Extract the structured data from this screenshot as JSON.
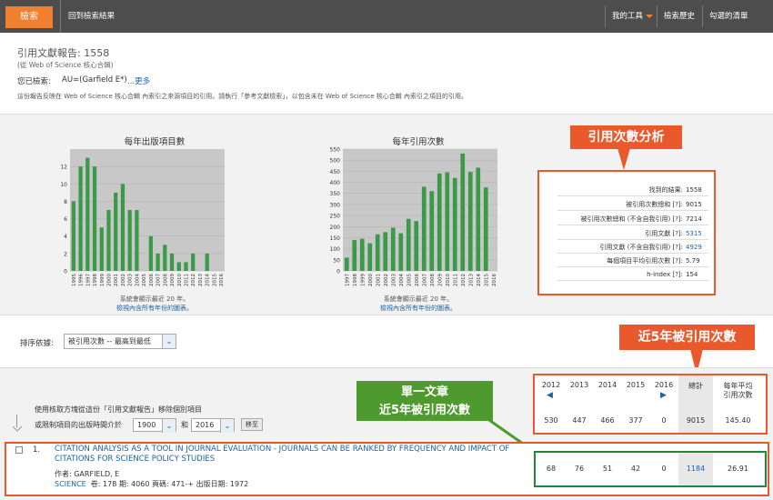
{
  "topbar": {
    "search_tab": "檢索",
    "back_link": "回到檢索結果",
    "tools": "我的工具",
    "history": "檢索歷史",
    "marked": "勾選的清單"
  },
  "report": {
    "title": "引用文獻報告: 1558",
    "subtitle": "(從 Web of Science 核心合輯)",
    "query_label": "您已檢索:",
    "query_value": "AU=(Garfield E*)",
    "more": "...更多",
    "note": "這份報告反映在 Web of Science 核心合輯 內索引之來源項目的引用。請執行「參考文獻檢索」，以包含未在 Web of Science 核心合輯 內索引之項目的引用。"
  },
  "charts": {
    "pubs_title": "每年出版項目數",
    "cites_title": "每年引用次數",
    "note": "系統會顯示最近 20 年。",
    "link": "檢視內含所有年份的圖表。"
  },
  "chart_data": [
    {
      "type": "bar",
      "title": "每年出版項目數",
      "categories": [
        "1995",
        "1996",
        "1997",
        "1998",
        "1999",
        "2000",
        "2001",
        "2002",
        "2003",
        "2004",
        "2005",
        "2006",
        "2007",
        "2008",
        "2009",
        "2010",
        "2011",
        "2012",
        "2013",
        "2014",
        "2015",
        "2016"
      ],
      "values": [
        8,
        12,
        13,
        12,
        5,
        7,
        9,
        10,
        7,
        7,
        0,
        4,
        2,
        3,
        2,
        1,
        1,
        2,
        0,
        2,
        0,
        0
      ],
      "yticks": [
        0,
        2,
        4,
        6,
        8,
        10,
        12
      ],
      "ylim": [
        0,
        14
      ],
      "color": "#3a9a4a"
    },
    {
      "type": "bar",
      "title": "每年引用次數",
      "categories": [
        "1997",
        "1998",
        "1999",
        "2000",
        "2001",
        "2002",
        "2003",
        "2004",
        "2005",
        "2006",
        "2007",
        "2008",
        "2009",
        "2010",
        "2011",
        "2012",
        "2013",
        "2014",
        "2015",
        "2016"
      ],
      "values": [
        60,
        140,
        145,
        125,
        165,
        175,
        195,
        170,
        235,
        225,
        380,
        360,
        440,
        445,
        420,
        530,
        447,
        466,
        377,
        0
      ],
      "yticks": [
        0,
        50,
        100,
        150,
        200,
        250,
        300,
        350,
        400,
        450,
        500,
        550
      ],
      "ylim": [
        0,
        550
      ],
      "color": "#3a9a4a"
    }
  ],
  "stats": {
    "rows": [
      {
        "label": "找到的結果:",
        "value": "1558",
        "link": false
      },
      {
        "label": "被引用次數總和 [?]:",
        "value": "9015",
        "link": false
      },
      {
        "label": "被引用次數總和 (不含自我引用) [?]:",
        "value": "7214",
        "link": false
      },
      {
        "label": "引用文獻 [?]:",
        "value": "5315",
        "link": true
      },
      {
        "label": "引用文獻 (不含自我引用) [?]:",
        "value": "4929",
        "link": true
      },
      {
        "label": "每個項目平均引用次數 [?]:",
        "value": "5.79",
        "link": false
      },
      {
        "label": "h-index [?]:",
        "value": "154",
        "link": false
      }
    ]
  },
  "labels": {
    "cite_analysis": "引用次數分析",
    "five_year": "近5年被引用次數",
    "single_line1": "單一文章",
    "single_line2": "近5年被引用次數"
  },
  "sort": {
    "label": "排序依據:",
    "value": "被引用次數 -- 最高到最低"
  },
  "filter": {
    "exclude_text": "使用核取方塊從這份「引用文獻報告」移除個別項目",
    "range_label": "或限制項目的出版時間介於",
    "from_year": "1900",
    "and": "和",
    "to_year": "2016",
    "go": "移至"
  },
  "table": {
    "years": [
      "2012",
      "2013",
      "2014",
      "2015",
      "2016"
    ],
    "total_hdr": "總計",
    "avg_hdr1": "每年平均",
    "avg_hdr2": "引用次數",
    "totals": [
      "530",
      "447",
      "466",
      "377",
      "0"
    ],
    "grand_total": "9015",
    "grand_avg": "145.40"
  },
  "record": {
    "num": "1.",
    "title": "CITATION ANALYSIS AS A TOOL IN JOURNAL EVALUATION - JOURNALS CAN BE RANKED BY FREQUENCY AND IMPACT OF CITATIONS FOR SCIENCE POLICY STUDIES",
    "author": "作者: GARFIELD, E",
    "journal": "SCIENCE",
    "details": "卷: 178  期: 4060  頁碼: 471-+  出版日期: 1972",
    "cites": [
      "68",
      "76",
      "51",
      "42",
      "0"
    ],
    "total": "1184",
    "avg": "26.91"
  }
}
